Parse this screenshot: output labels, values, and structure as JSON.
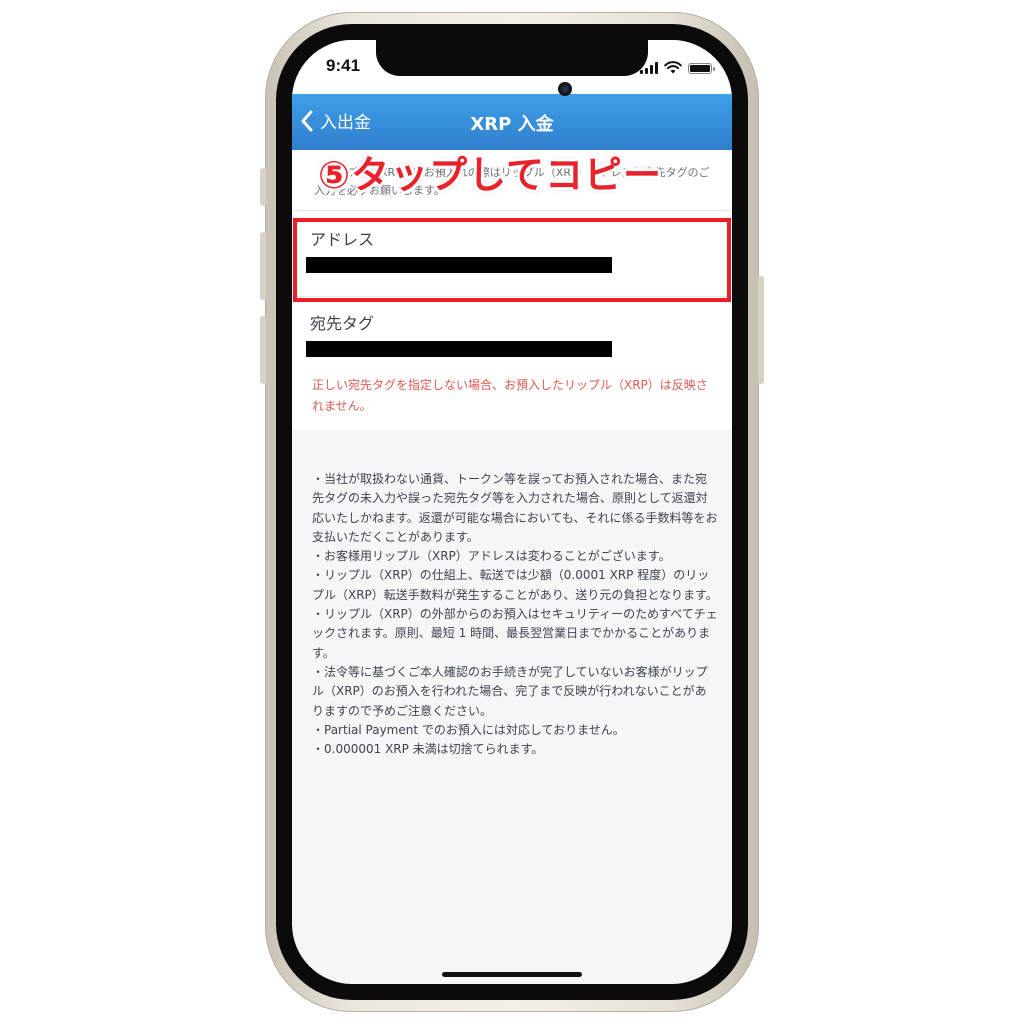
{
  "status_bar": {
    "time": "9:41"
  },
  "nav": {
    "back_label": "入出金",
    "title": "XRP 入金"
  },
  "intro": {
    "text": "・リップル（XRP）をお預入れの際はリップル（XRP）アドレスと宛先タグのご入力を必ずお願いします。"
  },
  "address": {
    "label": "アドレス",
    "value_redacted": true
  },
  "destination_tag": {
    "label": "宛先タグ",
    "value_redacted": true
  },
  "warning": "正しい宛先タグを指定しない場合、お預入したリップル（XRP）は反映されません。",
  "notes": [
    "・当社が取扱わない通貨、トークン等を誤ってお預入された場合、また宛先タグの未入力や誤った宛先タグ等を入力された場合、原則として返還対応いたしかねます。返還が可能な場合においても、それに係る手数料等をお支払いただくことがあります。",
    "・お客様用リップル（XRP）アドレスは変わることがございます。",
    "・リップル（XRP）の仕組上、転送では少額（0.0001 XRP 程度）のリップル（XRP）転送手数料が発生することがあり、送り元の負担となります。",
    "・リップル（XRP）の外部からのお預入はセキュリティーのためすべてチェックされます。原則、最短 1 時間、最長翌営業日までかかることがあります。",
    "・法令等に基づくご本人確認のお手続きが完了していないお客様がリップル（XRP）のお預入を行われた場合、完了まで反映が行われないことがありますので予めご注意ください。",
    "・Partial Payment でのお預入には対応しておりません。",
    "・0.000001 XRP 未満は切捨てられます。"
  ],
  "callout": {
    "text": "⑤タップしてコピー"
  },
  "colors": {
    "nav_gradient_top": "#3f9ee6",
    "nav_gradient_bottom": "#2f7fce",
    "warning": "#e05a50",
    "highlight": "#e81f26"
  },
  "icons": {
    "back": "chevron-left-icon"
  }
}
